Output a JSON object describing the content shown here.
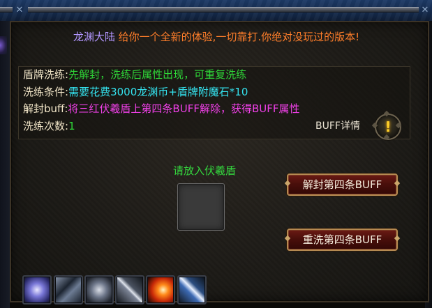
{
  "title": {
    "name": "龙渊大陆",
    "slogan": "给你一个全新的体验,一切靠打.你绝对没玩过的版本!"
  },
  "info": {
    "rows": [
      {
        "label": "盾牌洗练:",
        "value": "先解封，洗练后属性出现，可重复洗练",
        "color": "#2fd838"
      },
      {
        "label": "洗练条件:",
        "value": "需要花费3000龙渊币+盾牌附魔石*10",
        "color": "#34e2ee"
      },
      {
        "label": "解封buff:",
        "value": "将三红伏羲盾上第四条BUFF解除，获得BUFF属性",
        "color": "#f040e8"
      },
      {
        "label": "洗练次数:",
        "value": "1",
        "color": "#2fd838"
      }
    ],
    "buff_detail_label": "BUFF详情",
    "buff_detail_icon": "exclamation-icon"
  },
  "slot": {
    "prompt": "请放入伏羲盾"
  },
  "buttons": {
    "unlock": "解封第四条BUFF",
    "rewash": "重洗第四条BUFF"
  },
  "skillbar": {
    "icons": [
      "energy-orb-icon",
      "claw-strike-icon",
      "spark-burst-icon",
      "sword-slash-icon",
      "fire-blast-icon",
      "blade-icon"
    ]
  },
  "colors": {
    "title_name": "#b296ff",
    "title_slogan": "#ff7e2a",
    "label": "#f2e6c8",
    "slot_prompt": "#34d83e",
    "button_bg": "#4a0f0b",
    "button_border": "#b58a52"
  }
}
